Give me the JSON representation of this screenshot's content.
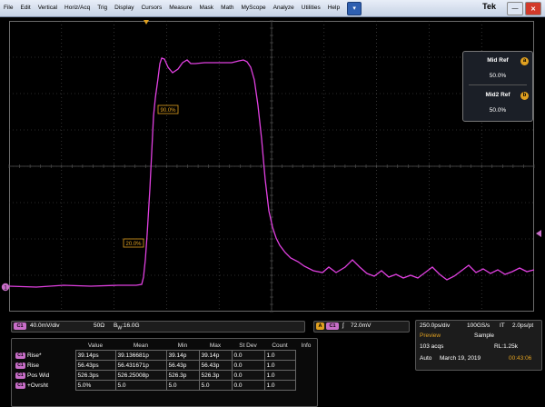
{
  "menu": {
    "items": [
      "File",
      "Edit",
      "Vertical",
      "Horiz/Acq",
      "Trig",
      "Display",
      "Cursors",
      "Measure",
      "Mask",
      "Math",
      "MyScope",
      "Analyze",
      "Utilities",
      "Help"
    ],
    "dropdown_glyph": "▾",
    "brand": "Tek",
    "minimize_glyph": "—",
    "close_glyph": "✕"
  },
  "colors": {
    "trace": "#e040e0",
    "grid": "#555555",
    "accent": "#e0a020",
    "channel": "#c86ec8"
  },
  "waveform": {
    "label_90": "90.0%",
    "label_20": "20.0%",
    "channel_marker": "1",
    "trigger_marker": "T"
  },
  "refs": {
    "mid_label": "Mid Ref",
    "mid_badge": "a",
    "mid_value": "50.0%",
    "mid2_label": "Mid2 Ref",
    "mid2_badge": "b",
    "mid2_value": "50.0%"
  },
  "channel": {
    "badge": "C1",
    "scale": "40.0mV/div",
    "impedance": "50Ω",
    "bw_prefix": "B",
    "bw_sub": "W",
    "bw_value": ":16.0G"
  },
  "trigger": {
    "auto_badge": "A",
    "badge": "C1",
    "slope": "∫",
    "level": "72.0mV"
  },
  "timebase": {
    "scale": "250.0ps/div",
    "samplerate": "100GS/s",
    "mode": "IT",
    "resolution": "2.0ps/pt",
    "run_state": "Preview",
    "acq_mode": "Sample",
    "acqs": "103 acqs",
    "record_length": "RL:1.25k",
    "trigger_mode": "Auto",
    "date": "March 19, 2019",
    "time": "00:43:06"
  },
  "measurements": {
    "headers": [
      "Value",
      "Mean",
      "Min",
      "Max",
      "St Dev",
      "Count",
      "Info"
    ],
    "rows": [
      {
        "badge": "C1",
        "name": "Rise*",
        "value": "39.14ps",
        "mean": "39.136681p",
        "min": "39.14p",
        "max": "39.14p",
        "stdev": "0.0",
        "count": "1.0",
        "info": ""
      },
      {
        "badge": "C1",
        "name": "Rise",
        "value": "56.43ps",
        "mean": "56.431671p",
        "min": "56.43p",
        "max": "56.43p",
        "stdev": "0.0",
        "count": "1.0",
        "info": ""
      },
      {
        "badge": "C1",
        "name": "Pos Wid",
        "value": "526.3ps",
        "mean": "526.25008p",
        "min": "526.3p",
        "max": "526.3p",
        "stdev": "0.0",
        "count": "1.0",
        "info": ""
      },
      {
        "badge": "C1",
        "name": "+Ovrsht",
        "value": "5.0%",
        "mean": "5.0",
        "min": "5.0",
        "max": "5.0",
        "stdev": "0.0",
        "count": "1.0",
        "info": ""
      }
    ]
  }
}
